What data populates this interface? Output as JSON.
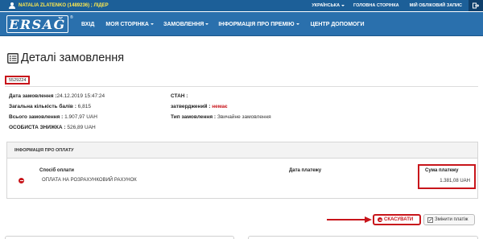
{
  "topbar": {
    "user_name": "NATALIA ZLATENKO (1489236) ; ЛІДЕР",
    "language": "УКРАЇНСЬКА",
    "home": "ГОЛОВНА СТОРІНКА",
    "account": "МІЙ ОБЛІКОВИЙ ЗАПИС"
  },
  "logo": {
    "text": "ERSAĞ",
    "reg": "®"
  },
  "nav": {
    "items": [
      {
        "label": "ВХІД",
        "has_caret": false
      },
      {
        "label": "МОЯ СТОРІНКА",
        "has_caret": true
      },
      {
        "label": "ЗАМОВЛЕННЯ",
        "has_caret": true
      },
      {
        "label": "ІНФОРМАЦІЯ ПРО ПРЕМІЮ",
        "has_caret": true
      },
      {
        "label": "ЦЕНТР ДОПОМОГИ",
        "has_caret": false
      }
    ]
  },
  "page": {
    "title": "Деталі замовлення",
    "order_number": "5529224"
  },
  "details": {
    "order_date_label": "Дата замовлення :",
    "order_date_value": "24.12.2019 15:47:24",
    "total_points_label": "Загальна кількість балів :",
    "total_points_value": "6,815",
    "total_label": "Всього замовлення :",
    "total_value": "1.907,97 UAH",
    "discount_label": "ОСОБИСТА ЗНИЖКА :",
    "discount_value": "526,89 UAH",
    "status_label": "СТАН :",
    "approved_label": "затверджений :",
    "approved_value": "немає",
    "order_type_label": "Тип замовлення :",
    "order_type_value": "Звичайне замовлення"
  },
  "payment": {
    "section_title": "ІНФОРМАЦІЯ ПРО ОПЛАТУ",
    "col_method": "Спосіб оплати",
    "col_date": "Дата платежу",
    "col_sum": "Сума платежу",
    "rows": [
      {
        "method": "ОПЛАТА НА РОЗРАХУНКОВИЙ РАХУНОК",
        "date": "",
        "sum": "1.381,08 UAH"
      }
    ]
  },
  "actions": {
    "cancel_label": "СКАСУВАТИ",
    "change_label": "Змінити платіж"
  },
  "colors": {
    "brand_blue": "#2a70ad",
    "topbar_blue": "#1c5f98",
    "highlight_red": "#c8151b",
    "user_yellow": "#ffe94d"
  }
}
